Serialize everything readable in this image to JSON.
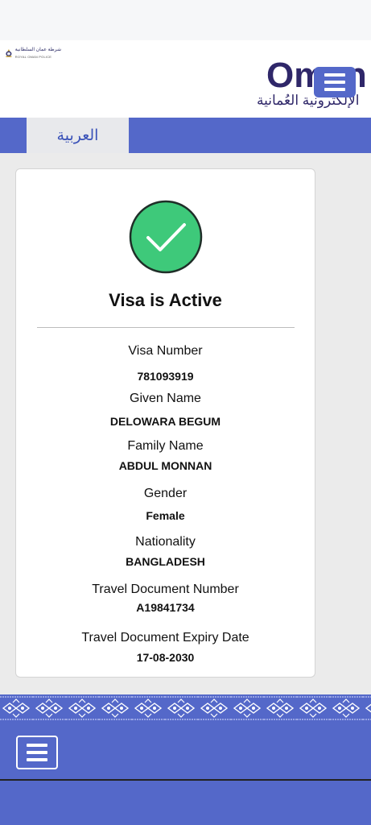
{
  "header": {
    "police_logo_ar": "شرطة عمان السلطانية",
    "police_logo_en": "ROYAL OMAN POLICE",
    "brand_title": "Oman e",
    "brand_subtitle": "الإلكترونية العُمانية"
  },
  "language": {
    "arabic_tab": "العربية"
  },
  "visa": {
    "status_title": "Visa is Active",
    "fields": [
      {
        "label": "Visa Number",
        "value": "781093919"
      },
      {
        "label": "Given Name",
        "value": "DELOWARA BEGUM"
      },
      {
        "label": "Family Name",
        "value": "ABDUL MONNAN"
      },
      {
        "label": "Gender",
        "value": "Female"
      },
      {
        "label": "Nationality",
        "value": "BANGLADESH"
      },
      {
        "label": "Travel Document Number",
        "value": "A19841734"
      },
      {
        "label": "Travel Document Expiry Date",
        "value": "17-08-2030"
      }
    ]
  },
  "colors": {
    "primary_blue": "#5468c9",
    "success_green": "#2ecc71",
    "brand_purple": "#2f2769"
  },
  "icons": {
    "status": "check-circle-icon",
    "menu": "hamburger-menu-icon"
  }
}
